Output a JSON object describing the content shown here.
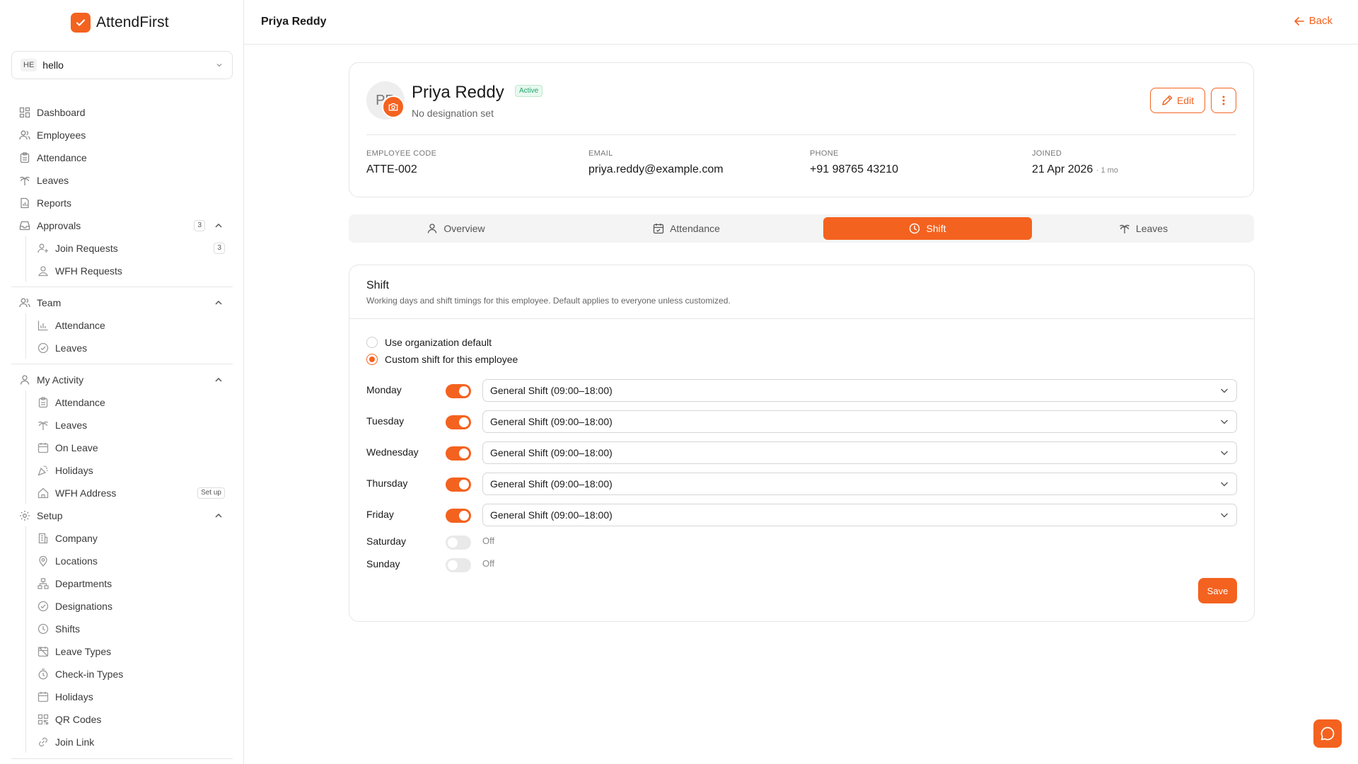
{
  "colors": {
    "accent": "#f4621f",
    "active_status": "#1ea56a"
  },
  "app": {
    "name": "AttendFirst"
  },
  "org": {
    "initials": "HE",
    "name": "hello"
  },
  "sidebar": {
    "dashboard": "Dashboard",
    "employees": "Employees",
    "attendance": "Attendance",
    "leaves": "Leaves",
    "reports": "Reports",
    "approvals": {
      "label": "Approvals",
      "count": "3",
      "join_requests": {
        "label": "Join Requests",
        "count": "3"
      },
      "wfh_requests": "WFH Requests"
    },
    "team": {
      "label": "Team",
      "attendance": "Attendance",
      "leaves": "Leaves"
    },
    "my_activity": {
      "label": "My Activity",
      "attendance": "Attendance",
      "leaves": "Leaves",
      "on_leave": "On Leave",
      "holidays": "Holidays",
      "wfh_address": "WFH Address",
      "wfh_badge": "Set up"
    },
    "setup": {
      "label": "Setup",
      "company": "Company",
      "locations": "Locations",
      "departments": "Departments",
      "designations": "Designations",
      "shifts": "Shifts",
      "leave_types": "Leave Types",
      "checkin_types": "Check-in Types",
      "holidays": "Holidays",
      "qr_codes": "QR Codes",
      "join_link": "Join Link"
    }
  },
  "header": {
    "title": "Priya Reddy",
    "back": "Back"
  },
  "profile": {
    "initials": "PR",
    "name": "Priya Reddy",
    "status": "Active",
    "designation": "No designation set",
    "edit": "Edit",
    "fields": {
      "code_label": "EMPLOYEE CODE",
      "code": "ATTE-002",
      "email_label": "EMAIL",
      "email": "priya.reddy@example.com",
      "phone_label": "PHONE",
      "phone": "+91 98765 43210",
      "joined_label": "JOINED",
      "joined": "21 Apr 2026",
      "tenure": "· 1 mo"
    }
  },
  "tabs": {
    "overview": "Overview",
    "attendance": "Attendance",
    "shift": "Shift",
    "leaves": "Leaves"
  },
  "shift": {
    "title": "Shift",
    "description": "Working days and shift timings for this employee. Default applies to everyone unless customized.",
    "option_default": "Use organization default",
    "option_custom": "Custom shift for this employee",
    "selected_option": "custom",
    "days": [
      {
        "day": "Monday",
        "enabled": true,
        "shift": "General Shift (09:00–18:00)"
      },
      {
        "day": "Tuesday",
        "enabled": true,
        "shift": "General Shift (09:00–18:00)"
      },
      {
        "day": "Wednesday",
        "enabled": true,
        "shift": "General Shift (09:00–18:00)"
      },
      {
        "day": "Thursday",
        "enabled": true,
        "shift": "General Shift (09:00–18:00)"
      },
      {
        "day": "Friday",
        "enabled": true,
        "shift": "General Shift (09:00–18:00)"
      },
      {
        "day": "Saturday",
        "enabled": false,
        "off_label": "Off"
      },
      {
        "day": "Sunday",
        "enabled": false,
        "off_label": "Off"
      }
    ],
    "save": "Save"
  }
}
